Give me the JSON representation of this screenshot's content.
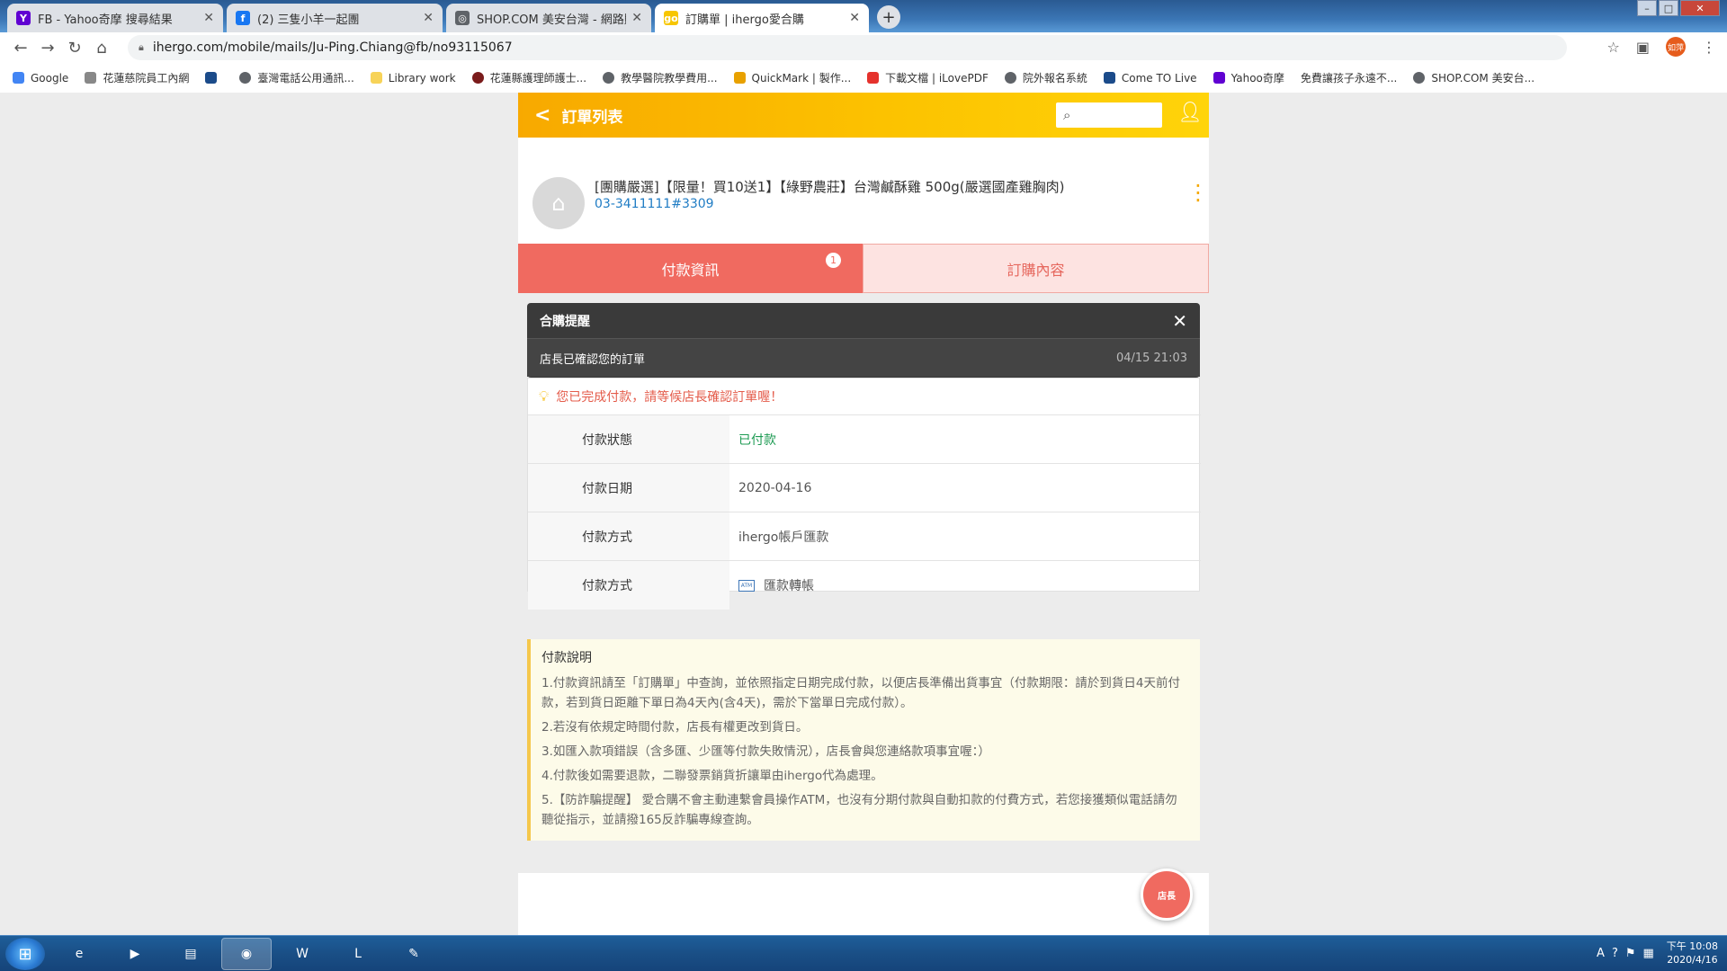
{
  "browser": {
    "tabs": [
      {
        "title": "FB - Yahoo奇摩 搜尋結果",
        "icon": "yahoo-icon",
        "color": "#6001d2"
      },
      {
        "title": "(2) 三隻小羊一起團",
        "icon": "facebook-icon",
        "color": "#1877f2"
      },
      {
        "title": "SHOP.COM 美安台灣 - 網路購物",
        "icon": "globe-icon",
        "color": "#5f6368"
      },
      {
        "title": "訂購單 | ihergo愛合購",
        "icon": "ihergo-icon",
        "color": "#f7c600"
      }
    ],
    "url": "ihergo.com/mobile/mails/Ju-Ping.Chiang@fb/no93115067",
    "profile": "如萍",
    "bookmarks": [
      "Google",
      "花蓮慈院員工內網",
      "",
      "臺灣電話公用通訊...",
      "Library work",
      "花蓮縣護理師護士...",
      "教學醫院教學費用...",
      "QuickMark | 製作...",
      "下載文檔 | iLovePDF",
      "院外報名系統",
      "Come TO Live",
      "Yahoo奇摩",
      "免費讓孩子永遠不...",
      "SHOP.COM 美安台..."
    ]
  },
  "header": {
    "back_icon": "chevron-left-icon",
    "title": "訂單列表",
    "search_icon": "search-icon",
    "user_icon": "user-icon"
  },
  "order": {
    "product": "[團購嚴選]【限量！買10送1】【綠野農莊】台灣鹹酥雞 500g(嚴選國產雞胸肉)",
    "phone": "03-3411111#3309"
  },
  "tabs": {
    "pay": "付款資訊",
    "content": "訂購內容",
    "badge": "1"
  },
  "notice": {
    "title": "合購提醒",
    "message": "店長已確認您的訂單",
    "time": "04/15 21:03"
  },
  "tip": "您已完成付款，請等候店長確認訂單喔！",
  "payment": [
    {
      "label": "付款狀態",
      "value": "已付款"
    },
    {
      "label": "付款日期",
      "value": "2020-04-16"
    },
    {
      "label": "付款方式",
      "value": "ihergo帳戶匯款"
    },
    {
      "label": "付款方式",
      "value": "匯款轉帳"
    }
  ],
  "explanation": {
    "title": "付款說明",
    "items": [
      "1.付款資訊請至「訂購單」中查詢，並依照指定日期完成付款，以便店長準備出貨事宜（付款期限：請於到貨日4天前付款，若到貨日距離下單日為4天內(含4天)，需於下當單日完成付款）。",
      "2.若沒有依規定時間付款，店長有權更改到貨日。",
      "3.如匯入款項錯誤（含多匯、少匯等付款失敗情況），店長會與您連絡款項事宜喔：）",
      "4.付款後如需要退款，二聯發票銷貨折讓單由ihergo代為處理。",
      "5.【防詐騙提醒】 愛合購不會主動連繫會員操作ATM，也沒有分期付款與自動扣款的付費方式，若您接獲類似電話請勿聽從指示，並請撥165反詐騙專線查詢。"
    ]
  },
  "fab_label": "店長",
  "taskbar": {
    "time": "下午 10:08",
    "date": "2020/4/16"
  },
  "colors": {
    "brand": "#fcc300",
    "tab_active": "#f06a60",
    "link": "#1f7cc4",
    "paid": "#1c9a52",
    "warning": "#e45b4a"
  }
}
